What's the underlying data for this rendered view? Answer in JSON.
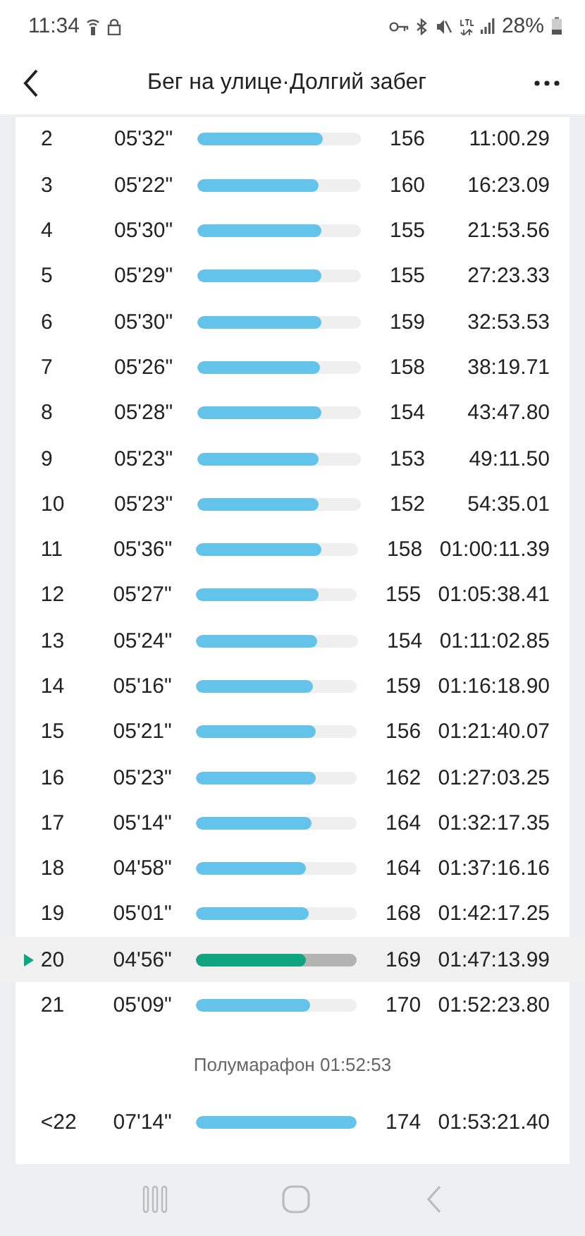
{
  "status_bar": {
    "time": "11:34",
    "battery": "28%"
  },
  "header": {
    "title": "Бег на улице·Долгий забег"
  },
  "laps": [
    {
      "number": "2",
      "pace": "05'32\"",
      "level": 0.77,
      "heart_rate": "156",
      "time": "11:00.29",
      "selected": false
    },
    {
      "number": "3",
      "pace": "05'22\"",
      "level": 0.74,
      "heart_rate": "160",
      "time": "16:23.09",
      "selected": false
    },
    {
      "number": "4",
      "pace": "05'30\"",
      "level": 0.76,
      "heart_rate": "155",
      "time": "21:53.56",
      "selected": false
    },
    {
      "number": "5",
      "pace": "05'29\"",
      "level": 0.76,
      "heart_rate": "155",
      "time": "27:23.33",
      "selected": false
    },
    {
      "number": "6",
      "pace": "05'30\"",
      "level": 0.76,
      "heart_rate": "159",
      "time": "32:53.53",
      "selected": false
    },
    {
      "number": "7",
      "pace": "05'26\"",
      "level": 0.75,
      "heart_rate": "158",
      "time": "38:19.71",
      "selected": false
    },
    {
      "number": "8",
      "pace": "05'28\"",
      "level": 0.76,
      "heart_rate": "154",
      "time": "43:47.80",
      "selected": false
    },
    {
      "number": "9",
      "pace": "05'23\"",
      "level": 0.74,
      "heart_rate": "153",
      "time": "49:11.50",
      "selected": false
    },
    {
      "number": "10",
      "pace": "05'23\"",
      "level": 0.74,
      "heart_rate": "152",
      "time": "54:35.01",
      "selected": false
    },
    {
      "number": "11",
      "pace": "05'36\"",
      "level": 0.77,
      "heart_rate": "158",
      "time": "01:00:11.39",
      "selected": false
    },
    {
      "number": "12",
      "pace": "05'27\"",
      "level": 0.76,
      "heart_rate": "155",
      "time": "01:05:38.41",
      "selected": false
    },
    {
      "number": "13",
      "pace": "05'24\"",
      "level": 0.75,
      "heart_rate": "154",
      "time": "01:11:02.85",
      "selected": false
    },
    {
      "number": "14",
      "pace": "05'16\"",
      "level": 0.73,
      "heart_rate": "159",
      "time": "01:16:18.90",
      "selected": false
    },
    {
      "number": "15",
      "pace": "05'21\"",
      "level": 0.74,
      "heart_rate": "156",
      "time": "01:21:40.07",
      "selected": false
    },
    {
      "number": "16",
      "pace": "05'23\"",
      "level": 0.74,
      "heart_rate": "162",
      "time": "01:27:03.25",
      "selected": false
    },
    {
      "number": "17",
      "pace": "05'14\"",
      "level": 0.72,
      "heart_rate": "164",
      "time": "01:32:17.35",
      "selected": false
    },
    {
      "number": "18",
      "pace": "04'58\"",
      "level": 0.68,
      "heart_rate": "164",
      "time": "01:37:16.16",
      "selected": false
    },
    {
      "number": "19",
      "pace": "05'01\"",
      "level": 0.7,
      "heart_rate": "168",
      "time": "01:42:17.25",
      "selected": false
    },
    {
      "number": "20",
      "pace": "04'56\"",
      "level": 0.68,
      "heart_rate": "169",
      "time": "01:47:13.99",
      "selected": true
    },
    {
      "number": "21",
      "pace": "05'09\"",
      "level": 0.71,
      "heart_rate": "170",
      "time": "01:52:23.80",
      "selected": false
    }
  ],
  "milestone": "Полумарафон 01:52:53",
  "final_lap": {
    "number": "<22",
    "pace": "07'14\"",
    "level": 1.0,
    "heart_rate": "174",
    "time": "01:53:21.40",
    "selected": false
  }
}
